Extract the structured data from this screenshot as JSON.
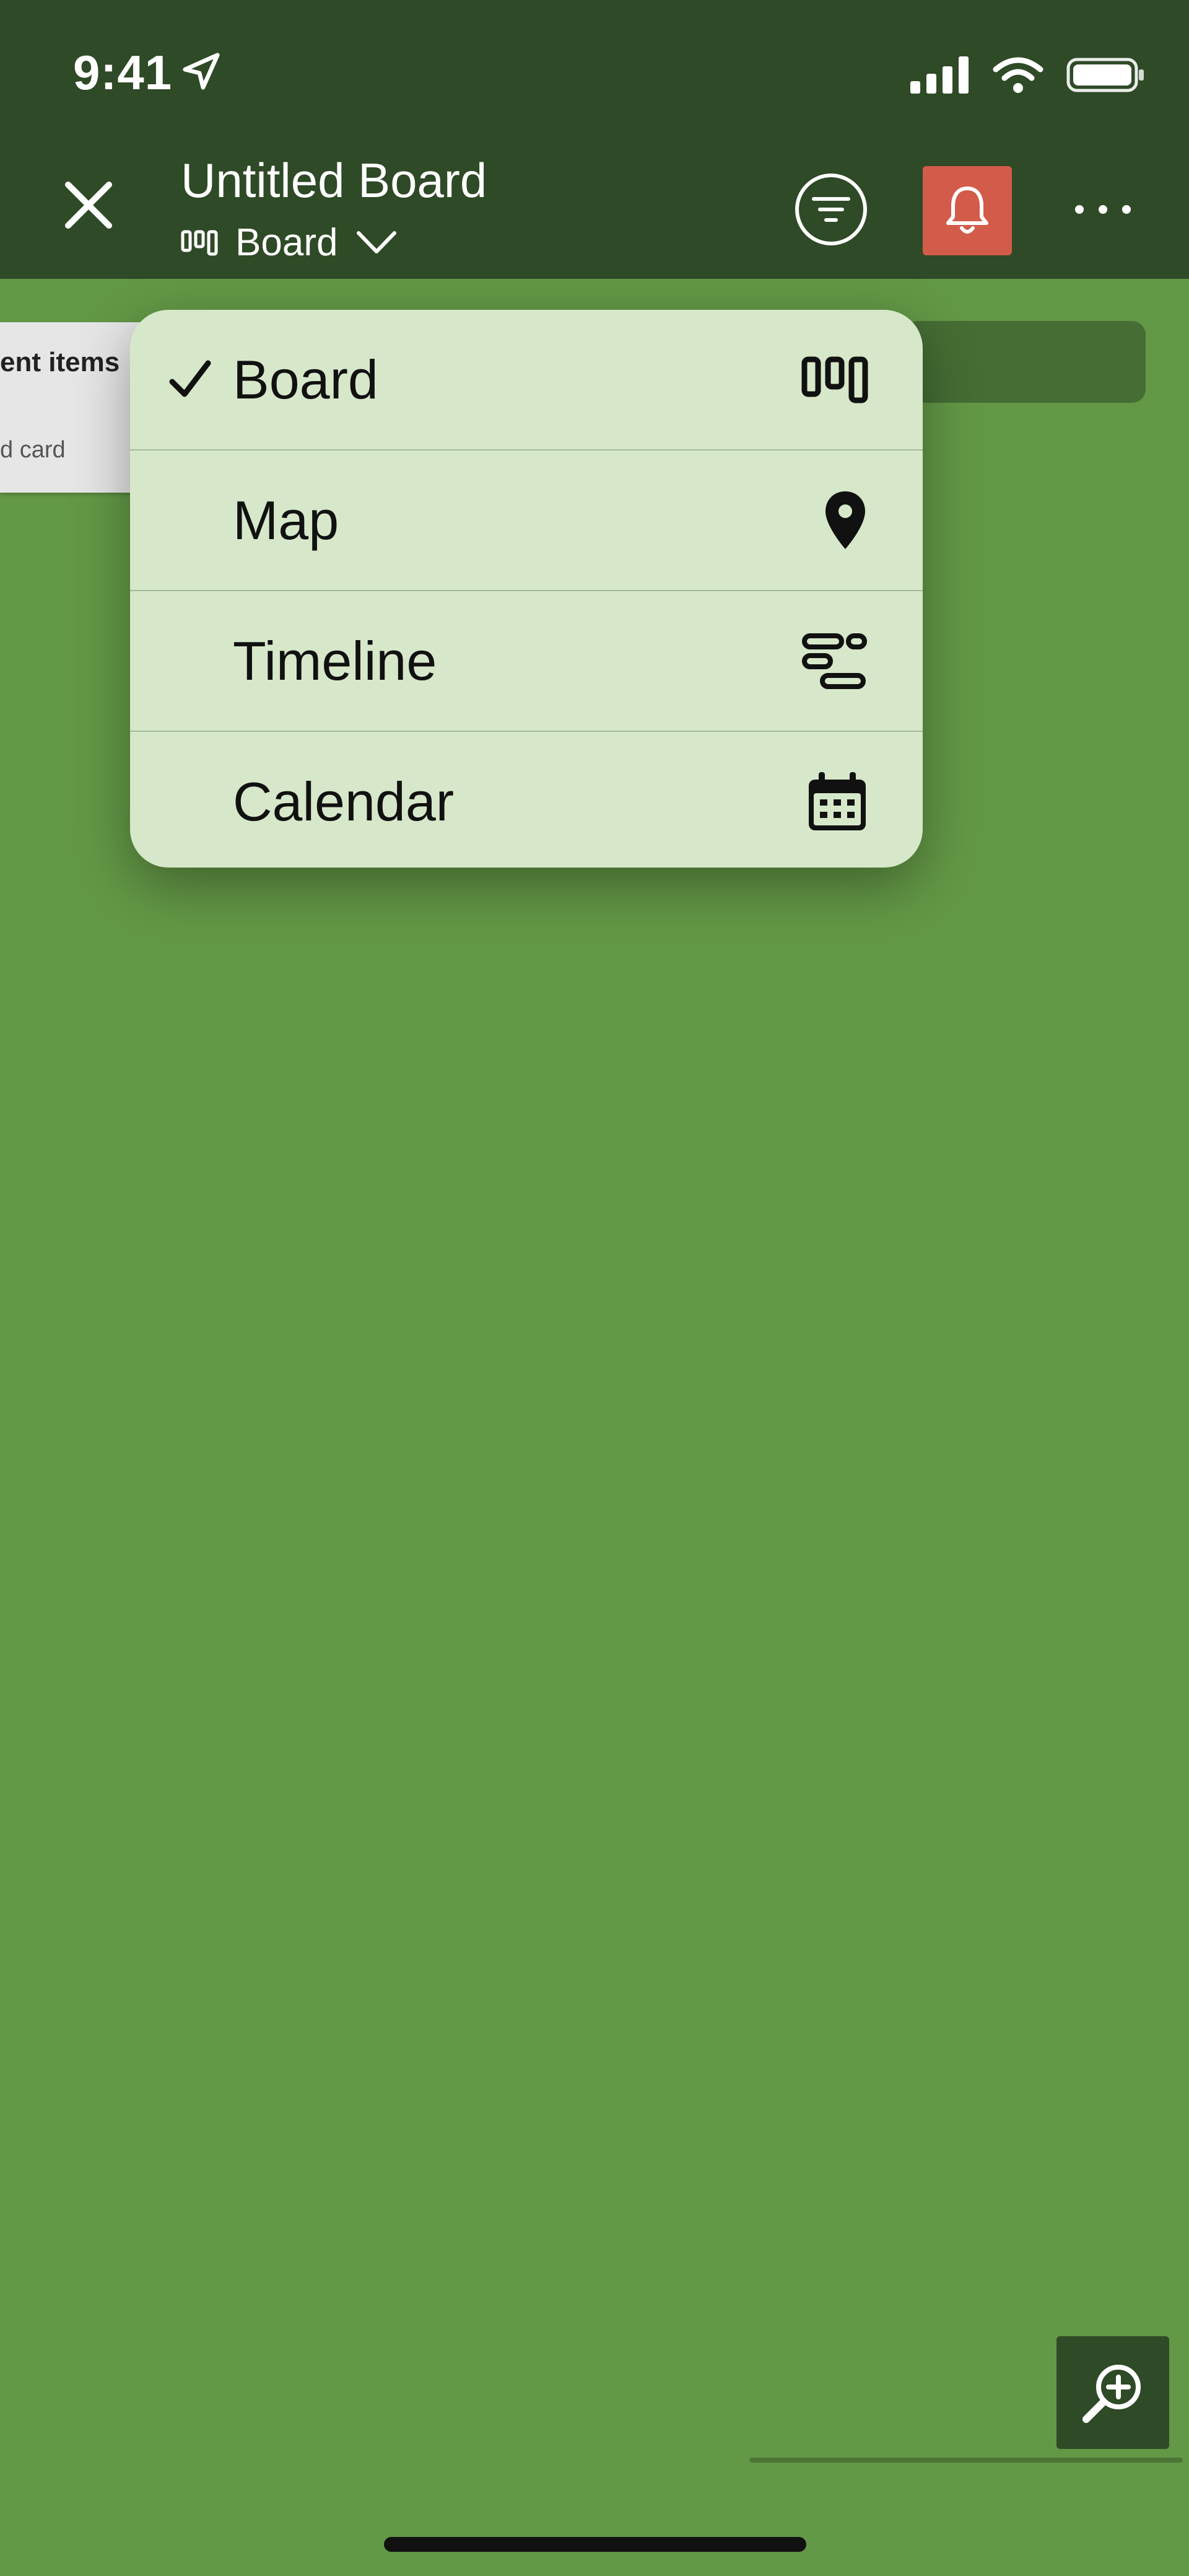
{
  "status_bar": {
    "time": "9:41"
  },
  "header": {
    "title": "Untitled Board",
    "view_label": "Board"
  },
  "board": {
    "left_card_title": "ent items",
    "left_card_hint": "d card"
  },
  "dropdown": {
    "items": [
      {
        "label": "Board",
        "selected": true,
        "icon": "board-view-icon"
      },
      {
        "label": "Map",
        "selected": false,
        "icon": "map-pin-icon"
      },
      {
        "label": "Timeline",
        "selected": false,
        "icon": "timeline-icon"
      },
      {
        "label": "Calendar",
        "selected": false,
        "icon": "calendar-icon"
      }
    ]
  },
  "colors": {
    "background": "#639846",
    "header": "#2f4a26",
    "notification_button": "#d35b4a",
    "dropdown": "#d6e8c9"
  }
}
